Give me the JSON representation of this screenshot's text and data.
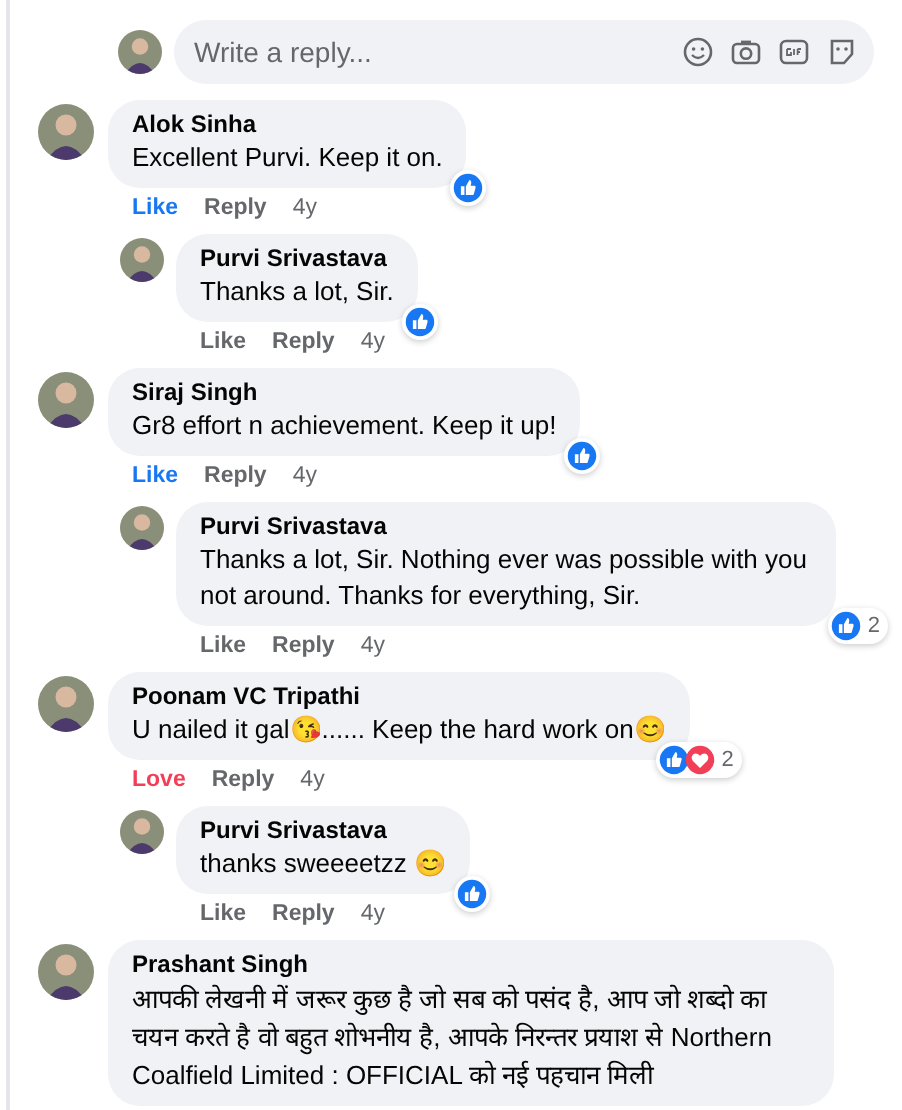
{
  "reply_box": {
    "placeholder": "Write a reply..."
  },
  "comments": [
    {
      "kind": "comment",
      "author": "Alok Sinha",
      "text": "Excellent Purvi. Keep it on.",
      "reactions": [
        {
          "kind": "like"
        }
      ],
      "actions": [
        {
          "label": "Like",
          "kind": "like",
          "active": true
        },
        {
          "label": "Reply",
          "kind": "reply"
        }
      ],
      "time": "4y"
    },
    {
      "kind": "reply",
      "author": "Purvi Srivastava",
      "text": "Thanks a lot, Sir.",
      "reactions": [
        {
          "kind": "like"
        }
      ],
      "actions": [
        {
          "label": "Like",
          "kind": "like",
          "active": false
        },
        {
          "label": "Reply",
          "kind": "reply"
        }
      ],
      "time": "4y"
    },
    {
      "kind": "comment",
      "author": "Siraj Singh",
      "text": "Gr8 effort n achievement. Keep it up!",
      "reactions": [
        {
          "kind": "like"
        }
      ],
      "actions": [
        {
          "label": "Like",
          "kind": "like",
          "active": true
        },
        {
          "label": "Reply",
          "kind": "reply"
        }
      ],
      "time": "4y"
    },
    {
      "kind": "reply",
      "author": "Purvi Srivastava",
      "text": "Thanks a lot, Sir. Nothing ever was possible with you not around. Thanks for everything, Sir.",
      "reactions": [
        {
          "kind": "like"
        }
      ],
      "reaction_count": "2",
      "actions": [
        {
          "label": "Like",
          "kind": "like",
          "active": false
        },
        {
          "label": "Reply",
          "kind": "reply"
        }
      ],
      "time": "4y"
    },
    {
      "kind": "comment",
      "author": "Poonam VC Tripathi",
      "text": "U nailed it gal😘...... Keep the hard work on😊",
      "reactions": [
        {
          "kind": "like"
        },
        {
          "kind": "love"
        }
      ],
      "reaction_count": "2",
      "actions": [
        {
          "label": "Love",
          "kind": "love",
          "active": true
        },
        {
          "label": "Reply",
          "kind": "reply"
        }
      ],
      "time": "4y"
    },
    {
      "kind": "reply",
      "author": "Purvi Srivastava",
      "text": "thanks sweeeetzz 😊",
      "reactions": [
        {
          "kind": "like"
        }
      ],
      "actions": [
        {
          "label": "Like",
          "kind": "like",
          "active": false
        },
        {
          "label": "Reply",
          "kind": "reply"
        }
      ],
      "time": "4y"
    },
    {
      "kind": "comment",
      "author": "Prashant Singh",
      "text": "आपकी लेखनी में जरूर कुछ है जो सब को पसंद है, आप जो शब्दो का चयन करते है वो बहुत शोभनीय है, आपके निरन्तर प्रयाश से Northern Coalfield Limited : OFFICIAL को नई पहचान मिली"
    }
  ]
}
